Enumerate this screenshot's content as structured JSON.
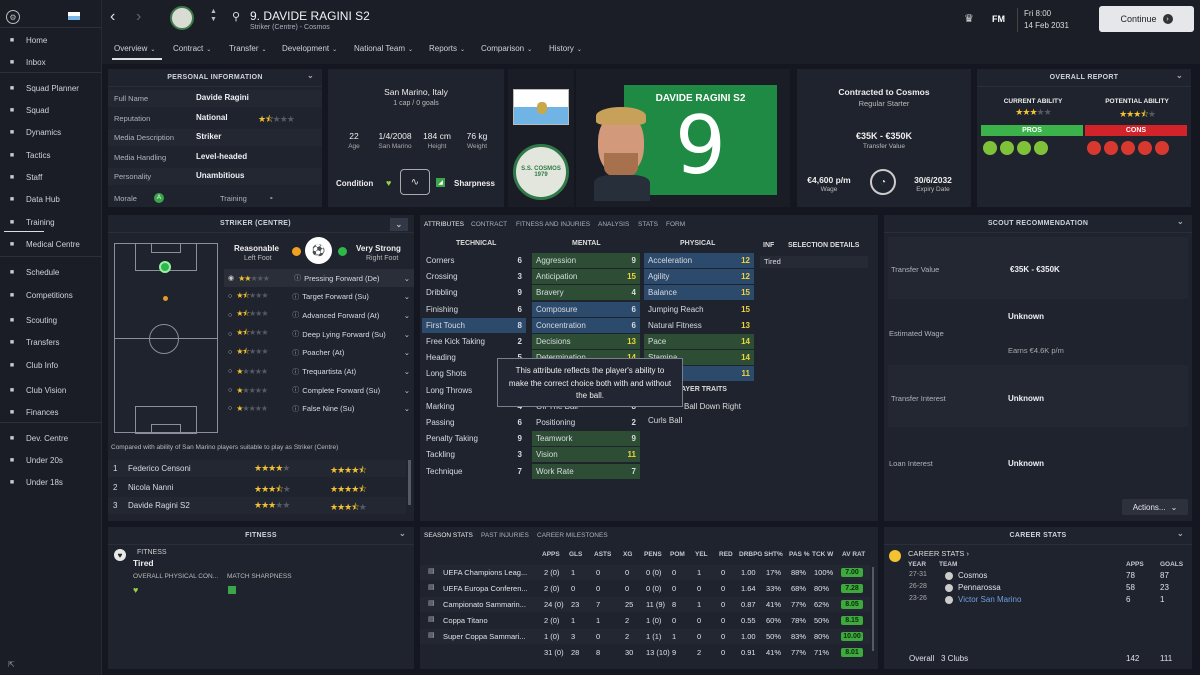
{
  "sidebar": {
    "items": [
      {
        "label": "Home",
        "icon": "home-icon"
      },
      {
        "label": "Inbox",
        "icon": "inbox-icon"
      },
      {
        "label": "Squad Planner",
        "icon": "squad-planner-icon"
      },
      {
        "label": "Squad",
        "icon": "squad-icon"
      },
      {
        "label": "Dynamics",
        "icon": "dynamics-icon"
      },
      {
        "label": "Tactics",
        "icon": "tactics-icon"
      },
      {
        "label": "Staff",
        "icon": "staff-icon"
      },
      {
        "label": "Data Hub",
        "icon": "data-hub-icon"
      },
      {
        "label": "Training",
        "icon": "training-icon"
      },
      {
        "label": "Medical Centre",
        "icon": "medical-icon"
      },
      {
        "label": "Schedule",
        "icon": "schedule-icon"
      },
      {
        "label": "Competitions",
        "icon": "trophy-icon"
      },
      {
        "label": "Scouting",
        "icon": "scouting-icon"
      },
      {
        "label": "Transfers",
        "icon": "transfers-icon"
      },
      {
        "label": "Club Info",
        "icon": "club-info-icon"
      },
      {
        "label": "Club Vision",
        "icon": "club-vision-icon"
      },
      {
        "label": "Finances",
        "icon": "finances-icon"
      },
      {
        "label": "Dev. Centre",
        "icon": "dev-centre-icon"
      },
      {
        "label": "Under 20s",
        "icon": "under20-icon"
      },
      {
        "label": "Under 18s",
        "icon": "under18-icon"
      }
    ]
  },
  "header": {
    "player_title": "9. DAVIDE RAGINI S2",
    "subtitle": "Striker (Centre) - Cosmos",
    "fm_label": "FM",
    "date_line1": "Fri 8:00",
    "date_line2": "14 Feb 2031",
    "continue_label": "Continue"
  },
  "nav_tabs": [
    {
      "label": "Overview"
    },
    {
      "label": "Contract"
    },
    {
      "label": "Transfer"
    },
    {
      "label": "Development"
    },
    {
      "label": "National Team"
    },
    {
      "label": "Reports"
    },
    {
      "label": "Comparison"
    },
    {
      "label": "History"
    }
  ],
  "personal": {
    "header": "PERSONAL INFORMATION",
    "rows": [
      {
        "label": "Full Name",
        "value": "Davide Ragini"
      },
      {
        "label": "Reputation",
        "value": "National"
      },
      {
        "label": "Media Description",
        "value": "Striker"
      },
      {
        "label": "Media Handling",
        "value": "Level-headed"
      },
      {
        "label": "Personality",
        "value": "Unambitious"
      }
    ],
    "morale_label": "Morale",
    "morale_badge": "A",
    "training_label": "Training",
    "training_value": "-"
  },
  "bio": {
    "nationality": "San Marino, Italy",
    "caps": "1 cap / 0 goals",
    "age": "22",
    "age_label": "Age",
    "dob": "1/4/2008",
    "dob_label": "San Marino",
    "height": "184 cm",
    "height_label": "Height",
    "weight": "76 kg",
    "weight_label": "Weight",
    "condition_label": "Condition",
    "sharpness_label": "Sharpness"
  },
  "shirt": {
    "name": "DAVIDE RAGINI S2",
    "number": "9",
    "colour": "#1f8a44"
  },
  "club_badge_text": "S.S. COSMOS 1979",
  "contract": {
    "title": "Contracted to Cosmos",
    "status": "Regular Starter",
    "value": "€35K - €350K",
    "value_label": "Transfer Value",
    "wage": "€4,600 p/m",
    "wage_label": "Wage",
    "expiry": "30/6/2032",
    "expiry_label": "Expiry Date"
  },
  "overall_report": {
    "header": "OVERALL REPORT",
    "ca_label": "CURRENT ABILITY",
    "pa_label": "POTENTIAL ABILITY",
    "ca_stars": 3,
    "pa_stars": 3.5,
    "pros_label": "PROS",
    "cons_label": "CONS"
  },
  "position_panel": {
    "header": "STRIKER (CENTRE)",
    "left_foot_rating": "Reasonable",
    "left_foot_label": "Left Foot",
    "right_foot_rating": "Very Strong",
    "right_foot_label": "Right Foot",
    "roles": [
      {
        "name": "Pressing Forward (De)",
        "stars": 2
      },
      {
        "name": "Target Forward (Su)",
        "stars": 1.5
      },
      {
        "name": "Advanced Forward (At)",
        "stars": 1.5
      },
      {
        "name": "Deep Lying Forward (Su)",
        "stars": 1.5
      },
      {
        "name": "Poacher (At)",
        "stars": 1.5
      },
      {
        "name": "Trequartista (At)",
        "stars": 1
      },
      {
        "name": "Complete Forward (Su)",
        "stars": 1
      },
      {
        "name": "False Nine (Su)",
        "stars": 1
      }
    ],
    "compare_text": "Compared with ability of San Marino players suitable to play as Striker (Centre)",
    "compare_rows": [
      {
        "rank": "1",
        "name": "Federico Censoni",
        "ca": 4,
        "pa": 4.5
      },
      {
        "rank": "2",
        "name": "Nicola Nanni",
        "ca": 3.5,
        "pa": 4.5
      },
      {
        "rank": "3",
        "name": "Davide Ragini S2",
        "ca": 3,
        "pa": 3.5
      }
    ]
  },
  "attr_tabs": [
    {
      "label": "ATTRIBUTES"
    },
    {
      "label": "CONTRACT"
    },
    {
      "label": "FITNESS AND INJURIES"
    },
    {
      "label": "ANALYSIS"
    },
    {
      "label": "STATS"
    },
    {
      "label": "FORM"
    }
  ],
  "attributes": {
    "technical_label": "TECHNICAL",
    "mental_label": "MENTAL",
    "physical_label": "PHYSICAL",
    "inf_label": "INF",
    "selection_label": "SELECTION DETAILS",
    "selection_value": "Tired",
    "technical": [
      {
        "name": "Corners",
        "value": "6"
      },
      {
        "name": "Crossing",
        "value": "3"
      },
      {
        "name": "Dribbling",
        "value": "9"
      },
      {
        "name": "Finishing",
        "value": "6"
      },
      {
        "name": "First Touch",
        "value": "8"
      },
      {
        "name": "Free Kick Taking",
        "value": "2"
      },
      {
        "name": "Heading",
        "value": "5"
      },
      {
        "name": "Long Shots",
        "value": "4"
      },
      {
        "name": "Long Throws",
        "value": "3"
      },
      {
        "name": "Marking",
        "value": "4"
      },
      {
        "name": "Passing",
        "value": "6"
      },
      {
        "name": "Penalty Taking",
        "value": "9"
      },
      {
        "name": "Tackling",
        "value": "3"
      },
      {
        "name": "Technique",
        "value": "7"
      }
    ],
    "mental": [
      {
        "name": "Aggression",
        "value": "9"
      },
      {
        "name": "Anticipation",
        "value": "15"
      },
      {
        "name": "Bravery",
        "value": "4"
      },
      {
        "name": "Composure",
        "value": "6"
      },
      {
        "name": "Concentration",
        "value": "6"
      },
      {
        "name": "Decisions",
        "value": "13"
      },
      {
        "name": "Determination",
        "value": "14"
      },
      {
        "name": "Flair",
        "value": "7"
      },
      {
        "name": "Leadership",
        "value": "5"
      },
      {
        "name": "Off The Ball",
        "value": "8"
      },
      {
        "name": "Positioning",
        "value": "2"
      },
      {
        "name": "Teamwork",
        "value": "9"
      },
      {
        "name": "Vision",
        "value": "11"
      },
      {
        "name": "Work Rate",
        "value": "7"
      }
    ],
    "physical": [
      {
        "name": "Acceleration",
        "value": "12"
      },
      {
        "name": "Agility",
        "value": "12"
      },
      {
        "name": "Balance",
        "value": "15"
      },
      {
        "name": "Jumping Reach",
        "value": "15"
      },
      {
        "name": "Natural Fitness",
        "value": "13"
      },
      {
        "name": "Pace",
        "value": "14"
      },
      {
        "name": "Stamina",
        "value": "14"
      },
      {
        "name": "Strength",
        "value": "11"
      }
    ],
    "player_traits_label": "PLAYER TRAITS",
    "traits": [
      "Ball Down Right",
      "Curls Ball"
    ],
    "tooltip": "This attribute reflects the player's ability to make the correct choice both with and without the ball."
  },
  "scout": {
    "header": "SCOUT RECOMMENDATION",
    "transfer_value_label": "Transfer Value",
    "transfer_value": "€35K - €350K",
    "wage_label": "Estimated Wage",
    "wage_value": "Unknown",
    "earns": "Earns €4.6K p/m",
    "interest_label": "Transfer Interest",
    "interest_value": "Unknown",
    "loan_label": "Loan Interest",
    "loan_value": "Unknown",
    "actions_label": "Actions..."
  },
  "fitness": {
    "header": "FITNESS",
    "label": "FITNESS",
    "value": "Tired",
    "overall_label": "OVERALL PHYSICAL CON...",
    "sharpness_label": "MATCH SHARPNESS"
  },
  "season_tabs": [
    {
      "label": "SEASON STATS"
    },
    {
      "label": "PAST INJURIES"
    },
    {
      "label": "CAREER MILESTONES"
    }
  ],
  "season_stats": {
    "columns": [
      "APPS",
      "GLS",
      "ASTS",
      "XG",
      "PENS",
      "POM",
      "YEL",
      "RED",
      "DRBPG",
      "SHT%",
      "PAS %",
      "TCK W",
      "AV RAT"
    ],
    "rows": [
      {
        "comp": "UEFA Champions Leag...",
        "vals": [
          "2 (0)",
          "1",
          "0",
          "0",
          "0 (0)",
          "0",
          "1",
          "0",
          "1.00",
          "17%",
          "88%",
          "100%"
        ],
        "rat": "7.00"
      },
      {
        "comp": "UEFA Europa Conferen...",
        "vals": [
          "2 (0)",
          "0",
          "0",
          "0",
          "0 (0)",
          "0",
          "0",
          "0",
          "1.64",
          "33%",
          "68%",
          "80%"
        ],
        "rat": "7.28"
      },
      {
        "comp": "Campionato Sammarin...",
        "vals": [
          "24 (0)",
          "23",
          "7",
          "25",
          "11 (9)",
          "8",
          "1",
          "0",
          "0.87",
          "41%",
          "77%",
          "62%"
        ],
        "rat": "8.05"
      },
      {
        "comp": "Coppa Titano",
        "vals": [
          "2 (0)",
          "1",
          "1",
          "2",
          "1 (0)",
          "0",
          "0",
          "0",
          "0.55",
          "60%",
          "78%",
          "50%"
        ],
        "rat": "8.15"
      },
      {
        "comp": "Super Coppa Sammari...",
        "vals": [
          "1 (0)",
          "3",
          "0",
          "2",
          "1 (1)",
          "1",
          "0",
          "0",
          "1.00",
          "50%",
          "83%",
          "80%"
        ],
        "rat": "10.00"
      },
      {
        "comp": "",
        "vals": [
          "31 (0)",
          "28",
          "8",
          "30",
          "13 (10)",
          "9",
          "2",
          "0",
          "0.91",
          "41%",
          "77%",
          "71%"
        ],
        "rat": "8.01"
      }
    ]
  },
  "career": {
    "header": "CAREER STATS",
    "link": "CAREER STATS ›",
    "year_label": "YEAR",
    "team_label": "TEAM",
    "apps_label": "APPS",
    "goals_label": "GOALS",
    "rows": [
      {
        "year": "27-31",
        "team": "Cosmos",
        "apps": "78",
        "goals": "87"
      },
      {
        "year": "26-28",
        "team": "Pennarossa",
        "apps": "58",
        "goals": "23"
      },
      {
        "year": "23-26",
        "team": "Victor San Marino",
        "apps": "6",
        "goals": "1"
      }
    ],
    "overall_label": "Overall",
    "overall_clubs": "3 Clubs",
    "overall_apps": "142",
    "overall_goals": "111"
  }
}
